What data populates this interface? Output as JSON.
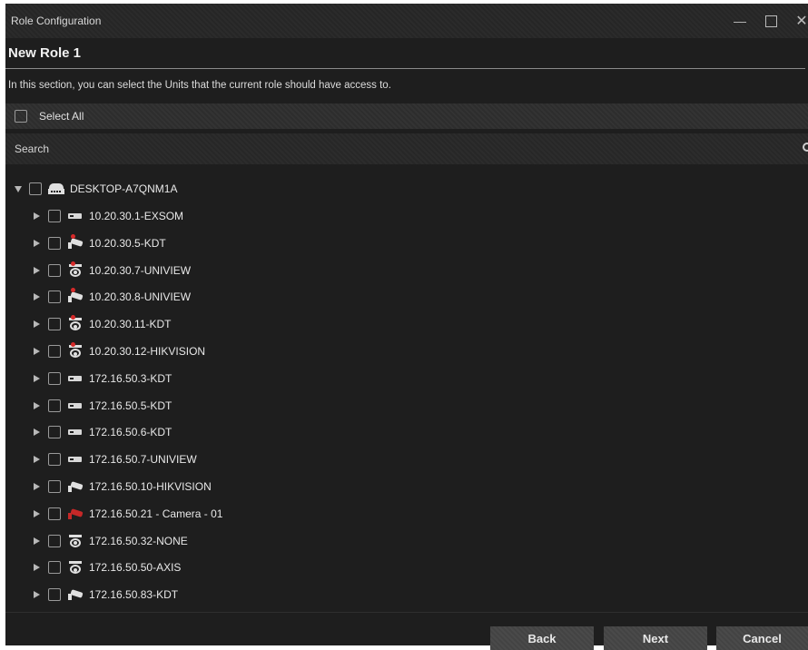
{
  "window": {
    "title": "Role Configuration",
    "controls": {
      "minimize": "—",
      "close": "✕"
    }
  },
  "role": {
    "name": "New Role 1",
    "description": "In this section, you can select the Units that the current role should have access to."
  },
  "select_all": {
    "label": "Select All",
    "checked": false
  },
  "search": {
    "placeholder": "Search"
  },
  "tree": {
    "root": {
      "label": "DESKTOP-A7QNM1A",
      "icon": "server-icon",
      "expanded": true,
      "checked": false
    },
    "children": [
      {
        "label": "10.20.30.1-EXSOM",
        "icon": "nvr-icon",
        "alert": false
      },
      {
        "label": "10.20.30.5-KDT",
        "icon": "bullet-camera-icon",
        "alert": true
      },
      {
        "label": "10.20.30.7-UNIVIEW",
        "icon": "dome-camera-icon",
        "alert": true
      },
      {
        "label": "10.20.30.8-UNIVIEW",
        "icon": "bullet-camera-icon",
        "alert": true
      },
      {
        "label": "10.20.30.11-KDT",
        "icon": "dome-camera-icon",
        "alert": true
      },
      {
        "label": "10.20.30.12-HIKVISION",
        "icon": "dome-camera-icon",
        "alert": true
      },
      {
        "label": "172.16.50.3-KDT",
        "icon": "nvr-icon",
        "alert": false
      },
      {
        "label": "172.16.50.5-KDT",
        "icon": "nvr-icon",
        "alert": false
      },
      {
        "label": "172.16.50.6-KDT",
        "icon": "nvr-icon",
        "alert": false
      },
      {
        "label": "172.16.50.7-UNIVIEW",
        "icon": "nvr-icon",
        "alert": false
      },
      {
        "label": "172.16.50.10-HIKVISION",
        "icon": "bullet-camera-icon",
        "alert": false
      },
      {
        "label": "172.16.50.21 - Camera - 01",
        "icon": "bullet-camera-icon-red",
        "alert": false
      },
      {
        "label": "172.16.50.32-NONE",
        "icon": "dome-camera-icon",
        "alert": false
      },
      {
        "label": "172.16.50.50-AXIS",
        "icon": "dome-camera-icon",
        "alert": false
      },
      {
        "label": "172.16.50.83-KDT",
        "icon": "bullet-camera-icon",
        "alert": false
      }
    ]
  },
  "buttons": {
    "back": "Back",
    "next": "Next",
    "cancel": "Cancel"
  },
  "colors": {
    "background": "#1e1e1e",
    "alert": "#d62a2a",
    "text": "#e6e6e6"
  }
}
